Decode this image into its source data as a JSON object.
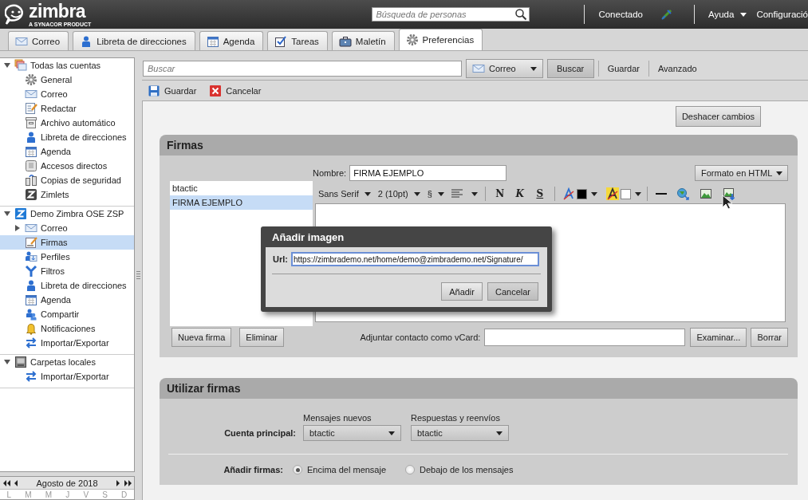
{
  "header": {
    "logo": "zimbra",
    "logo_tagline": "A SYNACOR PRODUCT",
    "people_search": {
      "placeholder": "Búsqueda de personas"
    },
    "status": "Conectado",
    "help_menu": "Ayuda",
    "settings_menu": "Configuració"
  },
  "app_tabs": [
    {
      "label": "Correo",
      "selected": false
    },
    {
      "label": "Libreta de direcciones",
      "selected": false
    },
    {
      "label": "Agenda",
      "selected": false
    },
    {
      "label": "Tareas",
      "selected": false
    },
    {
      "label": "Maletín",
      "selected": false
    },
    {
      "label": "Preferencias",
      "selected": true
    }
  ],
  "sidebar": {
    "sections": [
      {
        "label": "Todas las cuentas",
        "expanded": true,
        "children": [
          {
            "label": "General",
            "selected": false
          },
          {
            "label": "Correo",
            "selected": false
          },
          {
            "label": "Redactar",
            "selected": false
          },
          {
            "label": "Archivo automático",
            "selected": false
          },
          {
            "label": "Libreta de direcciones",
            "selected": false
          },
          {
            "label": "Agenda",
            "selected": false
          },
          {
            "label": "Accesos directos",
            "selected": false
          },
          {
            "label": "Copias de seguridad",
            "selected": false
          },
          {
            "label": "Zimlets",
            "selected": false
          }
        ]
      },
      {
        "label": "Demo Zimbra OSE ZSP",
        "expanded": true,
        "children": [
          {
            "label": "Correo",
            "selected": false,
            "expanded": false
          },
          {
            "label": "Firmas",
            "selected": true
          },
          {
            "label": "Perfiles",
            "selected": false
          },
          {
            "label": "Filtros",
            "selected": false
          },
          {
            "label": "Libreta de direcciones",
            "selected": false
          },
          {
            "label": "Agenda",
            "selected": false
          },
          {
            "label": "Compartir",
            "selected": false
          },
          {
            "label": "Notificaciones",
            "selected": false
          },
          {
            "label": "Importar/Exportar",
            "selected": false
          }
        ]
      },
      {
        "label": "Carpetas locales",
        "expanded": true,
        "children": [
          {
            "label": "Importar/Exportar",
            "selected": false
          }
        ]
      }
    ]
  },
  "mini_calendar": {
    "month": "Agosto de 2018",
    "weekdays": [
      "L",
      "M",
      "M",
      "J",
      "V",
      "S",
      "D"
    ]
  },
  "search_bar": {
    "placeholder": "Buscar",
    "scope": "Correo",
    "buttons": [
      "Buscar",
      "Guardar",
      "Avanzado"
    ]
  },
  "toolbar": {
    "buttons": [
      "Guardar",
      "Cancelar"
    ]
  },
  "undo_button": "Deshacer cambios",
  "signatures_panel": {
    "title": "Firmas",
    "signatures": [
      {
        "name": "btactic",
        "selected": false
      },
      {
        "name": "FIRMA EJEMPLO",
        "selected": true
      }
    ],
    "name_label": "Nombre:",
    "name_value": "FIRMA EJEMPLO",
    "format": "Formato en HTML",
    "editor_toolbar": {
      "font": "Sans Serif",
      "size": "2 (10pt)",
      "style": "§",
      "format_buttons": [
        "N",
        "K",
        "S"
      ]
    },
    "buttons": [
      "Nueva firma",
      "Eliminar"
    ],
    "vcard_label": "Adjuntar contacto como vCard:",
    "vcard_buttons": [
      "Examinar...",
      "Borrar"
    ]
  },
  "add_image_dialog": {
    "title": "Añadir imagen",
    "url_label": "Url:",
    "url_value": "https://zimbrademo.net/home/demo@zimbrademo.net/Signature/",
    "buttons": [
      "Añadir",
      "Cancelar"
    ]
  },
  "use_signatures_panel": {
    "title": "Utilizar firmas",
    "columns": [
      "Mensajes nuevos",
      "Respuestas y reenvíos"
    ],
    "account_label": "Cuenta principal:",
    "new_messages": "btactic",
    "replies": "btactic",
    "placement_label": "Añadir firmas:",
    "placement_options": [
      {
        "label": "Encima del mensaje",
        "selected": true
      },
      {
        "label": "Debajo de los mensajes",
        "selected": false
      }
    ]
  }
}
